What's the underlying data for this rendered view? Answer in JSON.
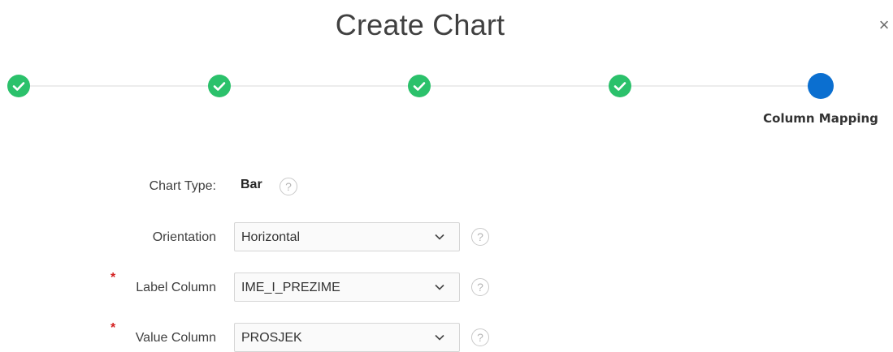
{
  "dialog": {
    "title": "Create Chart",
    "close_label": "×"
  },
  "wizard": {
    "steps": [
      {
        "status": "complete"
      },
      {
        "status": "complete"
      },
      {
        "status": "complete"
      },
      {
        "status": "complete"
      },
      {
        "status": "current",
        "label": "Column Mapping"
      }
    ],
    "colors": {
      "complete": "#2bc16b",
      "current": "#0b6fd0",
      "track": "#ececec"
    }
  },
  "form": {
    "chart_type": {
      "label": "Chart Type:",
      "value": "Bar",
      "help": "?"
    },
    "orientation": {
      "label": "Orientation",
      "value": "Horizontal",
      "help": "?"
    },
    "label_column": {
      "label": "Label Column",
      "value": "IME_I_PREZIME",
      "required_mark": "*",
      "help": "?"
    },
    "value_column": {
      "label": "Value Column",
      "value": "PROSJEK",
      "required_mark": "*",
      "help": "?"
    }
  },
  "icons": {
    "close": "close-icon",
    "step_done": "check-icon",
    "help": "help-icon",
    "select": "chevron-down-icon"
  }
}
